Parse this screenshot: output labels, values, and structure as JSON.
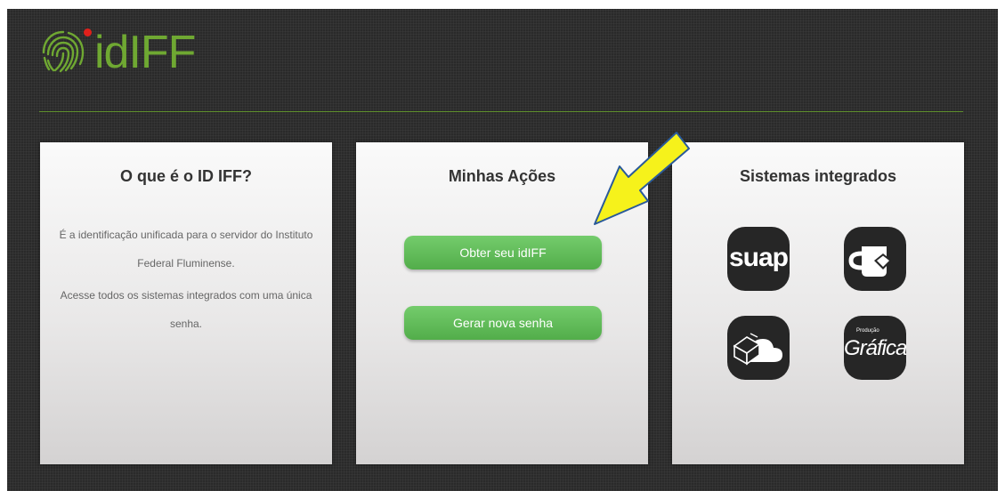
{
  "brand": {
    "logo_text": "idIFF"
  },
  "panels": {
    "about": {
      "title": "O que é o ID IFF?",
      "paragraph1": "É a identificação unificada para o servidor do Instituto Federal Fluminense.",
      "paragraph2": "Acesse todos os sistemas integrados com uma única senha."
    },
    "actions": {
      "title": "Minhas Ações",
      "obter_label": "Obter seu idIFF",
      "gerar_label": "Gerar nova senha"
    },
    "systems": {
      "title": "Sistemas integrados",
      "suap_label": "suap",
      "grafica_label": "Gráfica",
      "grafica_small": "Produção"
    }
  },
  "colors": {
    "accent_green": "#6fa832",
    "button_green": "#5cb85c",
    "arrow_yellow": "#f6f21b"
  },
  "icons": [
    "fingerprint-icon",
    "suap-icon",
    "coffee-cup-icon",
    "cloud-box-icon",
    "grafica-icon",
    "arrow-annotation"
  ]
}
